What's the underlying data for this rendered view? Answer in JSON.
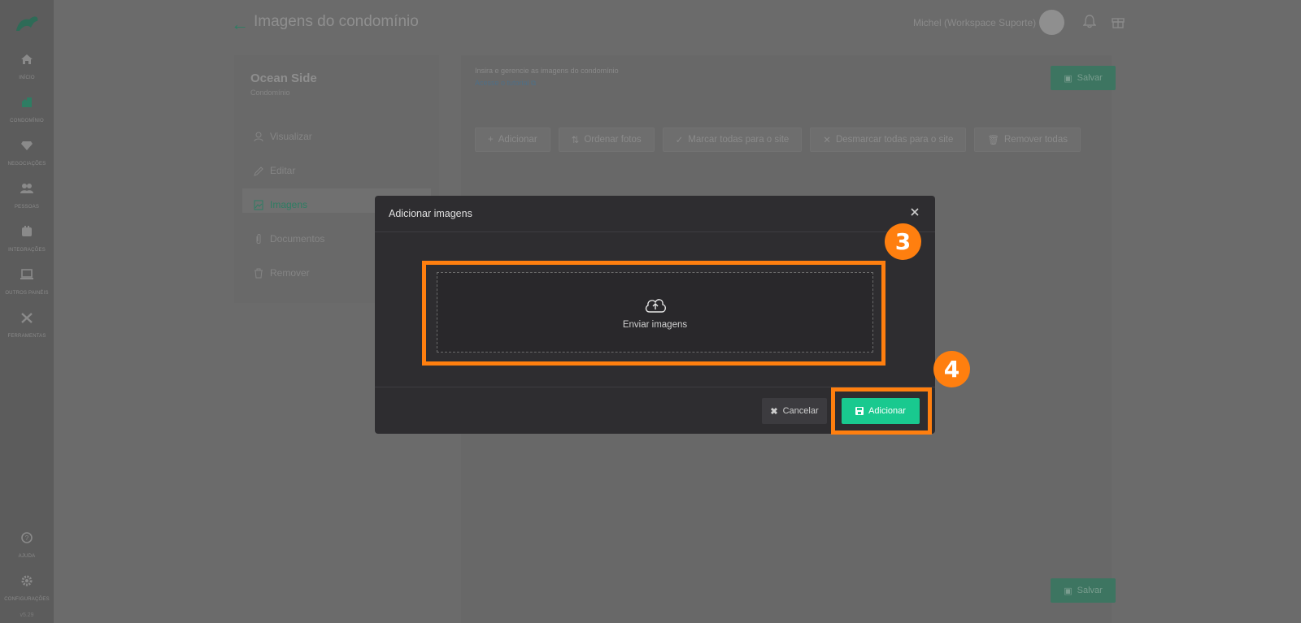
{
  "sidebar": {
    "items": [
      {
        "label": "Início",
        "icon": "home-icon"
      },
      {
        "label": "Condomínio",
        "icon": "building-icon"
      },
      {
        "label": "Negociações",
        "icon": "diamond-icon"
      },
      {
        "label": "Pessoas",
        "icon": "people-icon"
      },
      {
        "label": "Integrações",
        "icon": "integrations-icon"
      },
      {
        "label": "Outros painéis",
        "icon": "laptop-icon"
      },
      {
        "label": "Ferramentas",
        "icon": "tools-icon"
      }
    ],
    "bottom_items": [
      {
        "label": "Ajuda",
        "icon": "help-icon"
      },
      {
        "label": "Configurações",
        "icon": "gear-icon"
      }
    ],
    "version": "v5.29"
  },
  "header": {
    "title": "Imagens do condomínio",
    "user_name": "Michel (Workspace Suporte)"
  },
  "left_panel": {
    "name": "Ocean Side",
    "type": "Condomínio",
    "menu": [
      {
        "label": "Visualizar",
        "icon": "user-icon"
      },
      {
        "label": "Editar",
        "icon": "pencil-icon"
      },
      {
        "label": "Imagens",
        "icon": "image-icon"
      },
      {
        "label": "Documentos",
        "icon": "paperclip-icon"
      },
      {
        "label": "Remover",
        "icon": "trash-icon"
      }
    ]
  },
  "content": {
    "hint": "Insira e gerencie as imagens do condomínio",
    "hint_link": "Acesse o tutorial",
    "save_label": "Salvar",
    "toolbar": [
      {
        "label": "Adicionar",
        "icon": "plus-icon"
      },
      {
        "label": "Ordenar fotos",
        "icon": "sort-icon"
      },
      {
        "label": "Marcar todas para o site",
        "icon": "check-icon"
      },
      {
        "label": "Desmarcar todas para o site",
        "icon": "x-icon"
      },
      {
        "label": "Remover todas",
        "icon": "trash-icon"
      }
    ]
  },
  "modal": {
    "title": "Adicionar imagens",
    "dropzone_label": "Enviar imagens",
    "cancel_label": "Cancelar",
    "add_label": "Adicionar"
  },
  "annotations": {
    "step_3": "3",
    "step_4": "4",
    "highlight_color": "#ff7f0f"
  },
  "colors": {
    "accent": "#19c98f",
    "overlay_dim": "#6b6b6b"
  }
}
